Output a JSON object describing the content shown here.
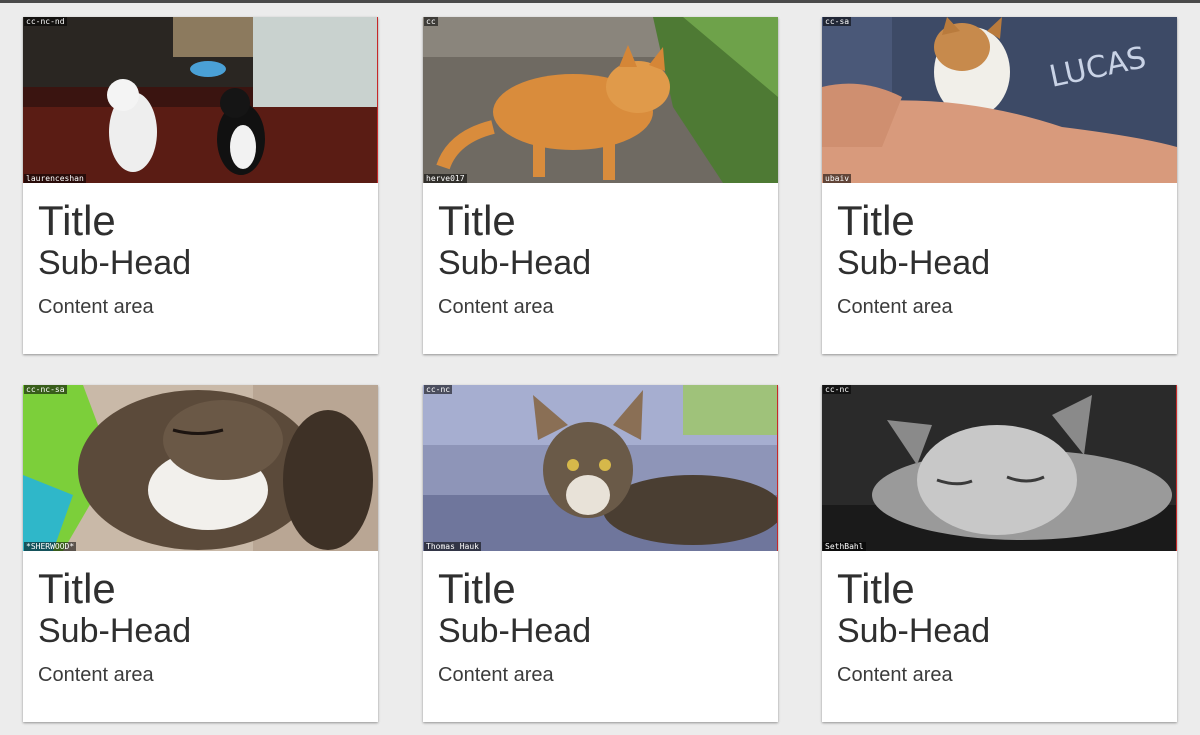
{
  "cards": [
    {
      "license": "cc-nc-nd",
      "author": "laurenceshan",
      "title": "Title",
      "subhead": "Sub-Head",
      "content": "Content area"
    },
    {
      "license": "cc",
      "author": "herve017",
      "title": "Title",
      "subhead": "Sub-Head",
      "content": "Content area"
    },
    {
      "license": "cc-sa",
      "author": "ubaiv",
      "title": "Title",
      "subhead": "Sub-Head",
      "content": "Content area"
    },
    {
      "license": "cc-nc-sa",
      "author": "*SHERWOOD*",
      "title": "Title",
      "subhead": "Sub-Head",
      "content": "Content area"
    },
    {
      "license": "cc-nc",
      "author": "Thomas Hauk",
      "title": "Title",
      "subhead": "Sub-Head",
      "content": "Content area"
    },
    {
      "license": "cc-nc",
      "author": "SethBahl",
      "title": "Title",
      "subhead": "Sub-Head",
      "content": "Content area"
    }
  ]
}
